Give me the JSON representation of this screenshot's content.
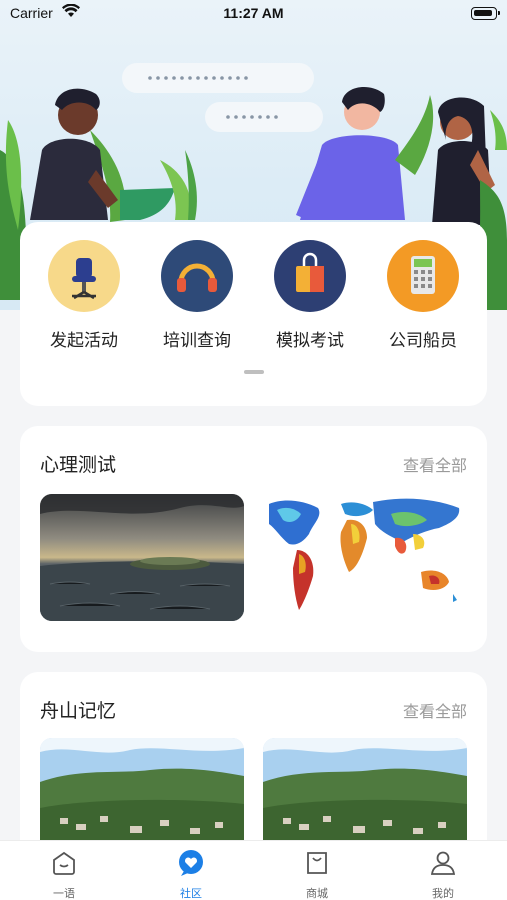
{
  "status_bar": {
    "carrier": "Carrier",
    "time": "11:27 AM"
  },
  "quick_actions": [
    {
      "label": "发起活动",
      "icon": "office-chair-icon",
      "color": "#f7d98a"
    },
    {
      "label": "培训查询",
      "icon": "headphones-icon",
      "color": "#2e4a78"
    },
    {
      "label": "模拟考试",
      "icon": "shopping-bag-icon",
      "color": "#2d3f73"
    },
    {
      "label": "公司船员",
      "icon": "calculator-icon",
      "color": "#f39a25"
    }
  ],
  "psychology": {
    "title": "心理测试",
    "more": "查看全部"
  },
  "zhoushan": {
    "title": "舟山记忆",
    "more": "查看全部"
  },
  "tabs": [
    {
      "label": "一语",
      "icon": "home-icon",
      "active": false
    },
    {
      "label": "社区",
      "icon": "community-heart-icon",
      "active": true
    },
    {
      "label": "商城",
      "icon": "shopping-bag-icon",
      "active": false
    },
    {
      "label": "我的",
      "icon": "profile-icon",
      "active": false
    }
  ],
  "colors": {
    "accent": "#1c7fe6",
    "muted": "#9a9a9a"
  }
}
